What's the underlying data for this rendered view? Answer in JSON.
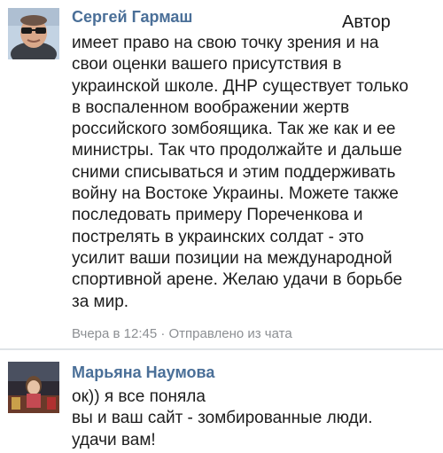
{
  "comments": [
    {
      "author": "Сергей Гармаш",
      "badge": "Автор",
      "lines": [
        "имеет право на свою точку зрения и на",
        "свои оценки вашего присутствия в",
        "украинской школе. ДНР существует только",
        "в воспаленном воображении жертв",
        "российского зомбоящика. Так же как и ее",
        "министры. Так что продолжайте и дальше",
        "сними списываться и этим поддерживать",
        "войну на Востоке Украины. Можете также",
        "последовать примеру Пореченкова и",
        "пострелять в украинских солдат - это",
        "усилит ваши позиции на международной",
        "спортивной арене. Желаю удачи в борьбе",
        "за мир."
      ],
      "meta": "Вчера в 12:45 · Отправлено из чата"
    },
    {
      "author": "Марьяна Наумова",
      "lines": [
        "ок)) я все поняла",
        "вы и ваш сайт - зомбированные люди.",
        "удачи вам!"
      ]
    }
  ]
}
